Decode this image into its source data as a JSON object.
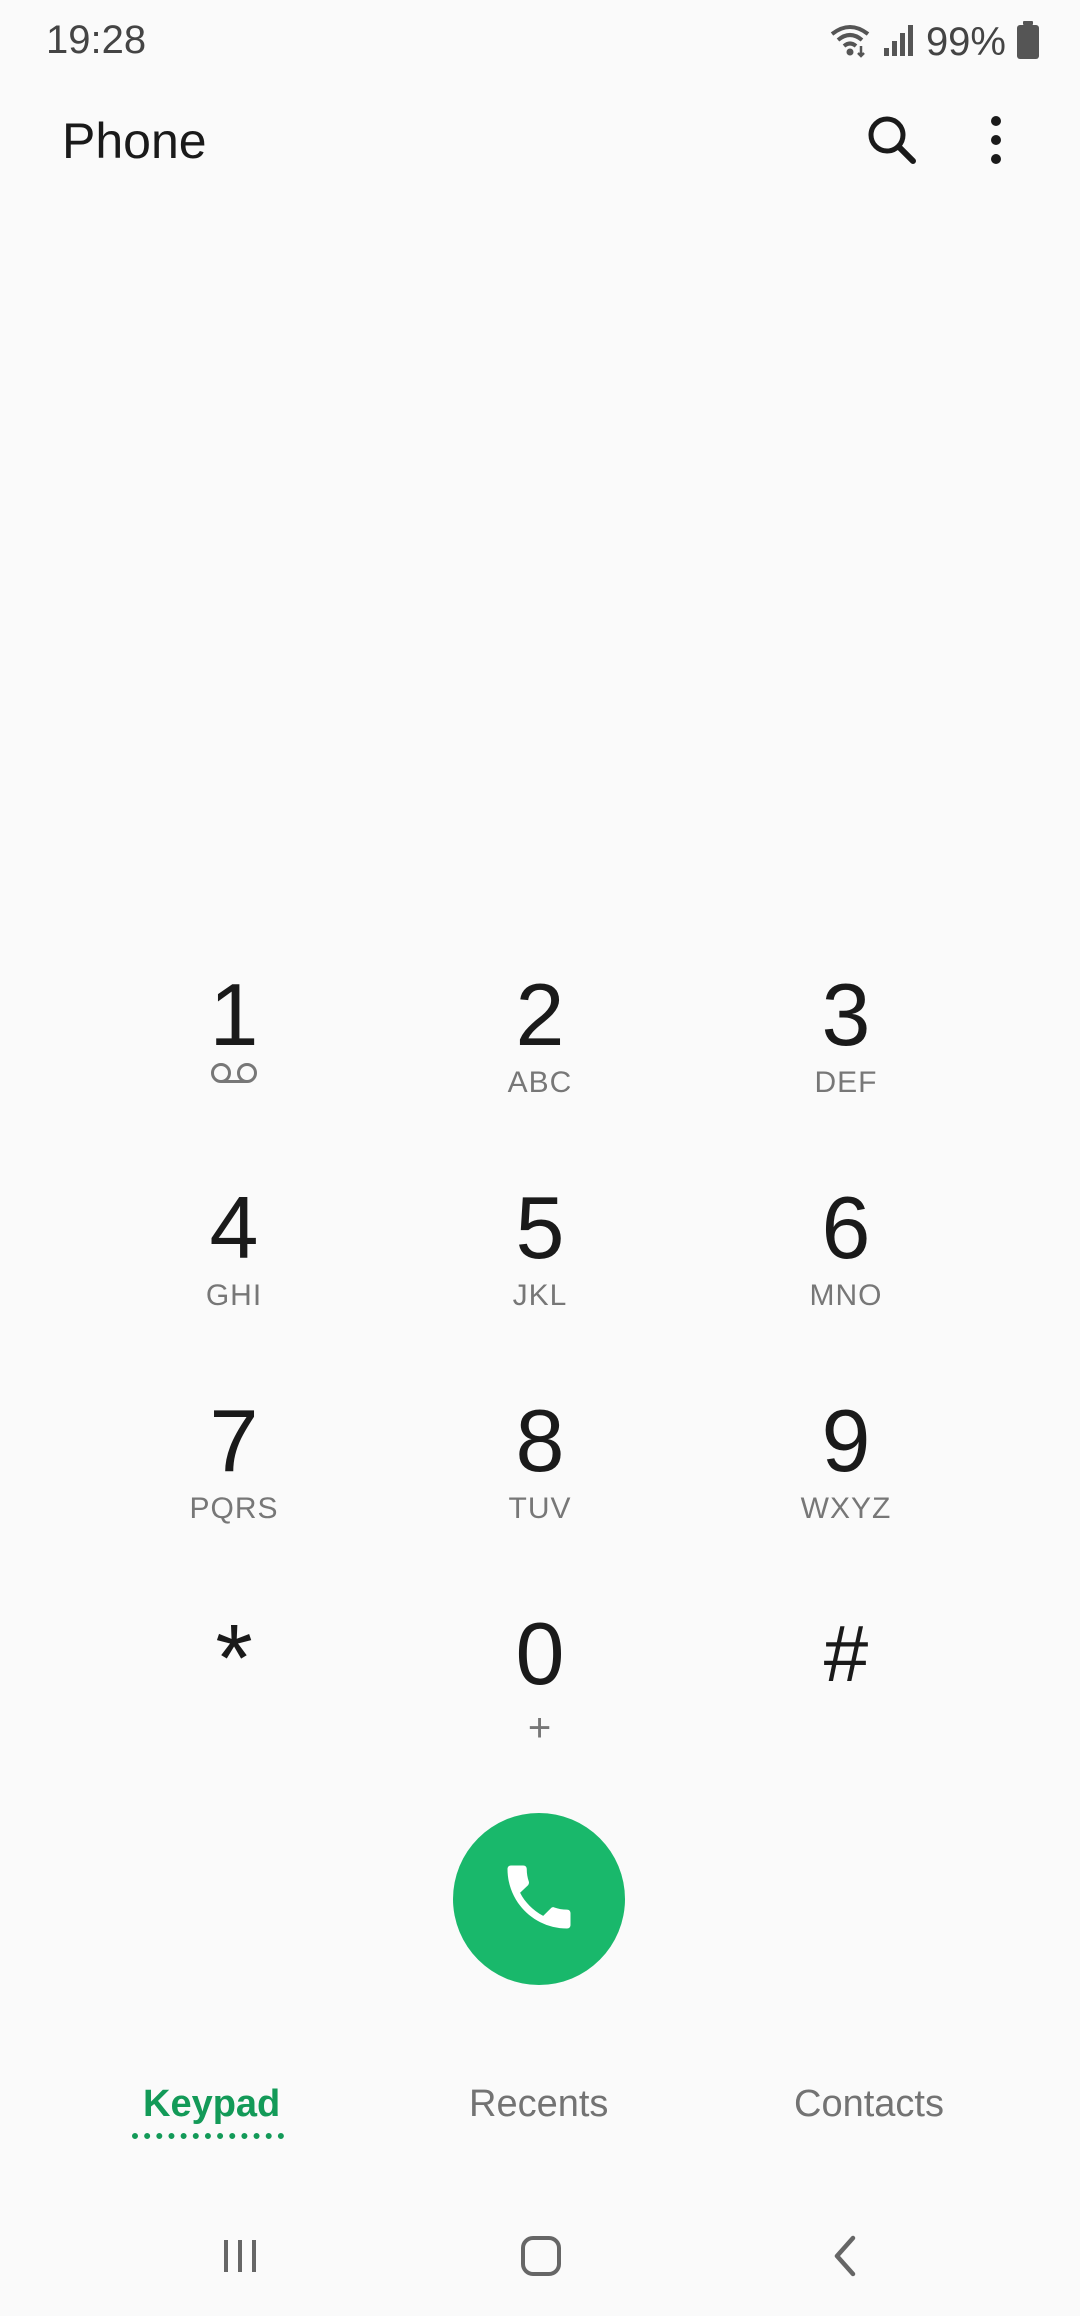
{
  "status_bar": {
    "time": "19:28",
    "battery": "99%",
    "icons": [
      "wifi-icon",
      "signal-icon",
      "battery-icon"
    ]
  },
  "app_bar": {
    "title": "Phone",
    "actions": [
      "search-icon",
      "more-options-icon"
    ]
  },
  "keypad": {
    "keys": [
      {
        "digit": "1",
        "sub": "",
        "sub_icon": "voicemail-icon"
      },
      {
        "digit": "2",
        "sub": "ABC"
      },
      {
        "digit": "3",
        "sub": "DEF"
      },
      {
        "digit": "4",
        "sub": "GHI"
      },
      {
        "digit": "5",
        "sub": "JKL"
      },
      {
        "digit": "6",
        "sub": "MNO"
      },
      {
        "digit": "7",
        "sub": "PQRS"
      },
      {
        "digit": "8",
        "sub": "TUV"
      },
      {
        "digit": "9",
        "sub": "WXYZ"
      },
      {
        "digit": "*",
        "sub": ""
      },
      {
        "digit": "0",
        "sub": "+"
      },
      {
        "digit": "#",
        "sub": ""
      }
    ]
  },
  "call_button": {
    "icon": "phone-icon",
    "color": "#19b86b"
  },
  "tabs": {
    "items": [
      {
        "label": "Keypad",
        "active": true
      },
      {
        "label": "Recents",
        "active": false
      },
      {
        "label": "Contacts",
        "active": false
      }
    ],
    "active_color": "#139a58"
  },
  "navbar": {
    "buttons": [
      "recent-apps-icon",
      "home-icon",
      "back-icon"
    ]
  }
}
